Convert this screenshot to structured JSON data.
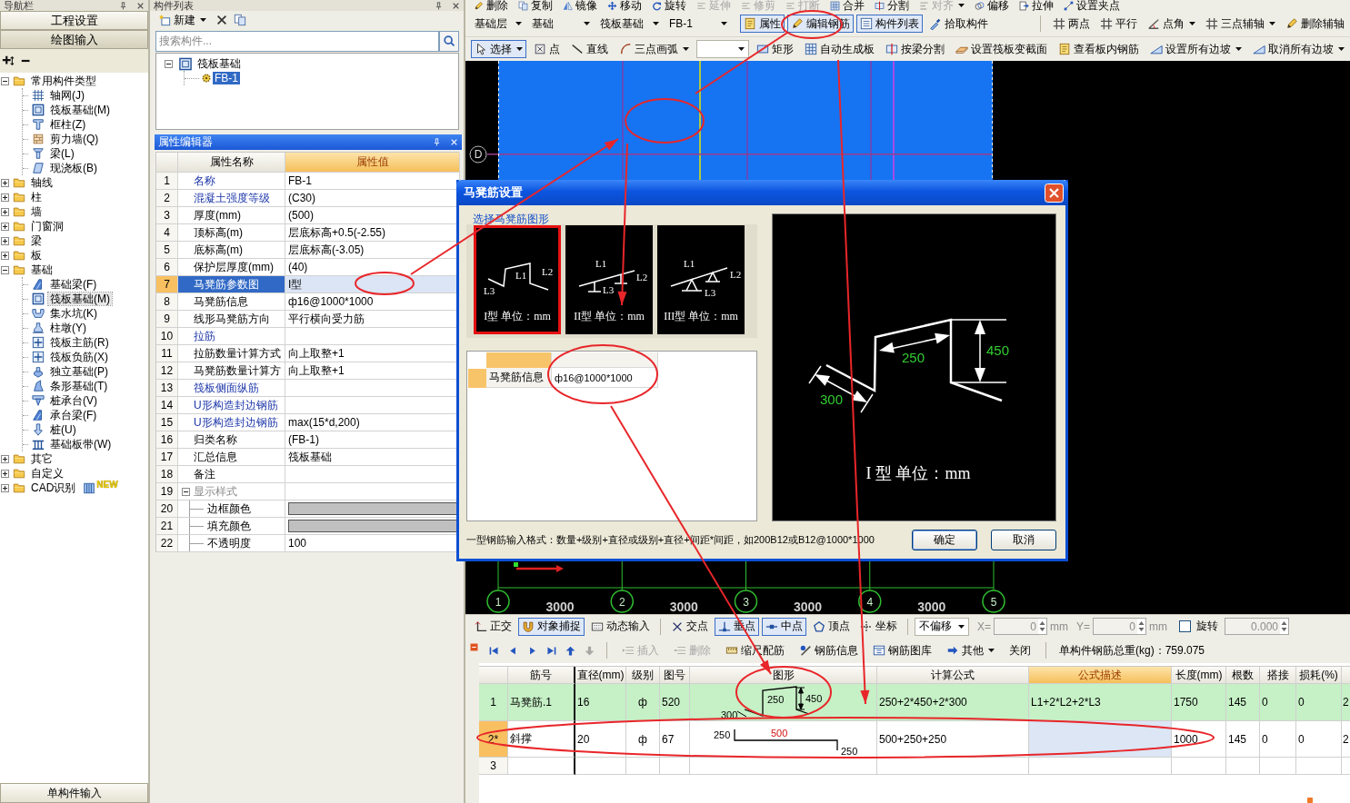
{
  "nav_panel": {
    "title": "导航栏",
    "buttons": [
      {
        "label": "工程设置",
        "selected": false
      },
      {
        "label": "绘图输入",
        "selected": true
      }
    ],
    "tree": [
      {
        "label": "常用构件类型",
        "kind": "folder",
        "expanded": true,
        "selected": false,
        "children": [
          {
            "label": "轴网(J)",
            "kind": "grid",
            "selected": false
          },
          {
            "label": "筏板基础(M)",
            "kind": "raft",
            "selected": false
          },
          {
            "label": "框柱(Z)",
            "kind": "column",
            "selected": false
          },
          {
            "label": "剪力墙(Q)",
            "kind": "wall",
            "selected": false
          },
          {
            "label": "梁(L)",
            "kind": "beam",
            "selected": false
          },
          {
            "label": "现浇板(B)",
            "kind": "slab",
            "selected": false
          }
        ]
      },
      {
        "label": "轴线",
        "kind": "folder",
        "expanded": false,
        "selected": false
      },
      {
        "label": "柱",
        "kind": "folder",
        "expanded": false,
        "selected": false
      },
      {
        "label": "墙",
        "kind": "folder",
        "expanded": false,
        "selected": false
      },
      {
        "label": "门窗洞",
        "kind": "folder",
        "expanded": false,
        "selected": false
      },
      {
        "label": "梁",
        "kind": "folder",
        "expanded": false,
        "selected": false
      },
      {
        "label": "板",
        "kind": "folder",
        "expanded": false,
        "selected": false
      },
      {
        "label": "基础",
        "kind": "folder",
        "expanded": true,
        "selected": false,
        "children": [
          {
            "label": "基础梁(F)",
            "kind": "footbeam",
            "selected": false
          },
          {
            "label": "筏板基础(M)",
            "kind": "raft",
            "selected": true
          },
          {
            "label": "集水坑(K)",
            "kind": "pit",
            "selected": false
          },
          {
            "label": "柱墩(Y)",
            "kind": "pier",
            "selected": false
          },
          {
            "label": "筏板主筋(R)",
            "kind": "rebar",
            "selected": false
          },
          {
            "label": "筏板负筋(X)",
            "kind": "rebar",
            "selected": false
          },
          {
            "label": "独立基础(P)",
            "kind": "footing",
            "selected": false
          },
          {
            "label": "条形基础(T)",
            "kind": "strip",
            "selected": false
          },
          {
            "label": "桩承台(V)",
            "kind": "cap",
            "selected": false
          },
          {
            "label": "承台梁(F)",
            "kind": "footbeam",
            "selected": false
          },
          {
            "label": "桩(U)",
            "kind": "pile",
            "selected": false
          },
          {
            "label": "基础板带(W)",
            "kind": "band",
            "selected": false
          }
        ]
      },
      {
        "label": "其它",
        "kind": "folder",
        "expanded": false,
        "selected": false
      },
      {
        "label": "自定义",
        "kind": "folder",
        "expanded": false,
        "selected": false
      },
      {
        "label": "CAD识别",
        "kind": "folder",
        "expanded": false,
        "selected": false,
        "badge": "NEW"
      }
    ],
    "footer_button": "单构件输入"
  },
  "component_list": {
    "title": "构件列表",
    "new_button": "新建",
    "search": {
      "placeholder": "搜索构件..."
    },
    "tree": [
      {
        "label": "筏板基础",
        "kind": "group",
        "expanded": true,
        "selected": false,
        "children": [
          {
            "label": "FB-1",
            "kind": "component",
            "selected": true
          }
        ]
      }
    ]
  },
  "property_editor": {
    "title": "属性编辑器",
    "columns": [
      {
        "label": "属性名称",
        "selected": false
      },
      {
        "label": "属性值",
        "selected": true
      }
    ],
    "rows": [
      {
        "index": "1",
        "name": "名称",
        "value": "FB-1",
        "kind": "text",
        "public": true,
        "selected": false
      },
      {
        "index": "2",
        "name": "混凝土强度等级",
        "value": "(C30)",
        "kind": "text",
        "public": true,
        "selected": false
      },
      {
        "index": "3",
        "name": "厚度(mm)",
        "value": "(500)",
        "kind": "text",
        "public": false,
        "selected": false
      },
      {
        "index": "4",
        "name": "顶标高(m)",
        "value": "层底标高+0.5(-2.55)",
        "kind": "text",
        "public": false,
        "selected": false
      },
      {
        "index": "5",
        "name": "底标高(m)",
        "value": "层底标高(-3.05)",
        "kind": "text",
        "public": false,
        "selected": false
      },
      {
        "index": "6",
        "name": "保护层厚度(mm)",
        "value": "(40)",
        "kind": "text",
        "public": false,
        "selected": false
      },
      {
        "index": "7",
        "name": "马凳筋参数图",
        "value": "I型",
        "kind": "text",
        "public": true,
        "selected": true
      },
      {
        "index": "8",
        "name": "马凳筋信息",
        "value": "ф16@1000*1000",
        "kind": "text",
        "public": false,
        "selected": false
      },
      {
        "index": "9",
        "name": "线形马凳筋方向",
        "value": "平行横向受力筋",
        "kind": "text",
        "public": false,
        "selected": false
      },
      {
        "index": "10",
        "name": "拉筋",
        "kind": "text",
        "public": true,
        "selected": false
      },
      {
        "index": "11",
        "name": "拉筋数量计算方式",
        "value": "向上取整+1",
        "kind": "text",
        "public": false,
        "selected": false
      },
      {
        "index": "12",
        "name": "马凳筋数量计算方",
        "value": "向上取整+1",
        "kind": "text",
        "public": false,
        "selected": false
      },
      {
        "index": "13",
        "name": "筏板侧面纵筋",
        "kind": "text",
        "public": true,
        "selected": false
      },
      {
        "index": "14",
        "name": "U形构造封边钢筋",
        "kind": "text",
        "public": true,
        "selected": false
      },
      {
        "index": "15",
        "name": "U形构造封边钢筋",
        "value": "max(15*d,200)",
        "kind": "text",
        "public": true,
        "selected": false
      },
      {
        "index": "16",
        "name": "归类名称",
        "value": "(FB-1)",
        "kind": "text",
        "public": false,
        "selected": false
      },
      {
        "index": "17",
        "name": "汇总信息",
        "value": "筏板基础",
        "kind": "text",
        "public": false,
        "selected": false
      },
      {
        "index": "18",
        "name": "备注",
        "kind": "text",
        "public": false,
        "selected": false
      },
      {
        "index": "19",
        "name": "显示样式",
        "kind": "group",
        "expanded": true,
        "public": false,
        "selected": false,
        "children": [
          {
            "index": "20",
            "name": "边框颜色",
            "kind": "swatch",
            "public": false,
            "selected": false
          },
          {
            "index": "21",
            "name": "填充颜色",
            "kind": "swatch",
            "public": false,
            "selected": false
          },
          {
            "index": "22",
            "name": "不透明度",
            "value": "100",
            "kind": "text",
            "public": false,
            "selected": false
          }
        ]
      }
    ]
  },
  "edit_toolbar": [
    {
      "label": "删除",
      "disabled": false,
      "dropdown": false
    },
    {
      "label": "复制",
      "disabled": false,
      "dropdown": false
    },
    {
      "label": "镜像",
      "disabled": false,
      "dropdown": false
    },
    {
      "label": "移动",
      "disabled": false,
      "dropdown": false
    },
    {
      "label": "旋转",
      "disabled": false,
      "dropdown": false
    },
    {
      "label": "延伸",
      "disabled": true,
      "dropdown": false
    },
    {
      "label": "修剪",
      "disabled": true,
      "dropdown": false
    },
    {
      "label": "打断",
      "disabled": true,
      "dropdown": false
    },
    {
      "label": "合并",
      "disabled": false,
      "dropdown": false
    },
    {
      "label": "分割",
      "disabled": false,
      "dropdown": false
    },
    {
      "label": "对齐",
      "disabled": true,
      "dropdown": true
    },
    {
      "label": "偏移",
      "disabled": false,
      "dropdown": false
    },
    {
      "label": "拉伸",
      "disabled": false,
      "dropdown": false
    },
    {
      "label": "设置夹点",
      "disabled": false,
      "dropdown": false
    }
  ],
  "layer_toolbar": {
    "selectors": [
      {
        "value": "基础层"
      },
      {
        "value": "基础"
      },
      {
        "value": "筏板基础"
      },
      {
        "value": "FB-1"
      }
    ],
    "buttons": [
      {
        "label": "属性",
        "pressed": true
      },
      {
        "label": "编辑钢筋",
        "pressed": true
      },
      {
        "label": "构件列表",
        "pressed": true
      },
      {
        "label": "拾取构件",
        "pressed": false
      }
    ],
    "axis_buttons": [
      {
        "label": "两点",
        "dropdown": false
      },
      {
        "label": "平行",
        "dropdown": false
      },
      {
        "label": "点角",
        "dropdown": true
      },
      {
        "label": "三点辅轴",
        "dropdown": true
      },
      {
        "label": "删除辅轴",
        "dropdown": false
      }
    ]
  },
  "draw_toolbar": [
    {
      "kind": "button",
      "label": "选择",
      "pressed": true,
      "dropdown": true
    },
    {
      "kind": "button",
      "label": "点",
      "pressed": false,
      "dropdown": false
    },
    {
      "kind": "button",
      "label": "直线",
      "pressed": false,
      "dropdown": false
    },
    {
      "kind": "button",
      "label": "三点画弧",
      "pressed": false,
      "dropdown": true
    },
    {
      "kind": "combo"
    },
    {
      "kind": "button",
      "label": "矩形",
      "pressed": false,
      "dropdown": false
    },
    {
      "kind": "button",
      "label": "自动生成板",
      "pressed": false,
      "dropdown": false
    },
    {
      "kind": "button",
      "label": "按梁分割",
      "pressed": false,
      "dropdown": false
    },
    {
      "kind": "button",
      "label": "设置筏板变截面",
      "pressed": false,
      "dropdown": false
    },
    {
      "kind": "button",
      "label": "查看板内钢筋",
      "pressed": false,
      "dropdown": false
    },
    {
      "kind": "button",
      "label": "设置所有边坡",
      "pressed": false,
      "dropdown": true
    },
    {
      "kind": "button",
      "label": "取消所有边坡",
      "pressed": false,
      "dropdown": true
    }
  ],
  "canvas": {
    "row_axes": [
      "D"
    ],
    "column_axes": [
      "1",
      "2",
      "3",
      "4",
      "5"
    ],
    "spacings": [
      "3000",
      "3000",
      "3000",
      "3000"
    ]
  },
  "dialog": {
    "title": "马凳筋设置",
    "group_label": "选择马凳筋图形",
    "shapes": [
      {
        "kind": "type1",
        "caption": "I型 单位：mm",
        "labels": [
          "L1",
          "L2",
          "L3"
        ],
        "selected": true
      },
      {
        "kind": "type2",
        "caption": "II型 单位：mm",
        "labels": [
          "L1",
          "L2",
          "L3"
        ],
        "selected": false
      },
      {
        "kind": "type3",
        "caption": "III型 单位：mm",
        "labels": [
          "L1",
          "L2",
          "L3"
        ],
        "selected": false
      }
    ],
    "info": {
      "label": "马凳筋信息",
      "value": "ф16@1000*1000"
    },
    "preview": {
      "kind": "type1",
      "dims": [
        "250",
        "450",
        "300"
      ],
      "caption": "I 型 单位：mm"
    },
    "hint": "一型钢筋输入格式：数量+级别+直径或级别+直径+间距*间距，如200B12或B12@1000*1000",
    "buttons": [
      {
        "label": "确定",
        "default": true
      },
      {
        "label": "取消",
        "default": false
      }
    ]
  },
  "snap_toolbar": {
    "modes": [
      {
        "label": "正交",
        "pressed": false
      },
      {
        "label": "对象捕捉",
        "pressed": true
      },
      {
        "label": "动态输入",
        "pressed": false
      }
    ],
    "snaps": [
      {
        "label": "交点",
        "pressed": false
      },
      {
        "label": "垂点",
        "pressed": true
      },
      {
        "label": "中点",
        "pressed": true
      },
      {
        "label": "顶点",
        "pressed": false
      },
      {
        "label": "坐标",
        "pressed": false
      }
    ],
    "offset_mode": "不偏移",
    "x": {
      "label": "X=",
      "value": "0",
      "unit": "mm",
      "disabled": true
    },
    "y": {
      "label": "Y=",
      "value": "0",
      "unit": "mm",
      "disabled": true
    },
    "rotate": {
      "label": "旋转",
      "checked": false,
      "value": "0.000"
    }
  },
  "rebar_panel": {
    "nav_buttons": [
      {
        "kind": "first",
        "disabled": false
      },
      {
        "kind": "prev",
        "disabled": false
      },
      {
        "kind": "next",
        "disabled": false
      },
      {
        "kind": "last",
        "disabled": false
      },
      {
        "kind": "up",
        "disabled": false
      },
      {
        "kind": "down",
        "disabled": true
      }
    ],
    "toolbar": [
      {
        "label": "插入",
        "disabled": true,
        "dropdown": false
      },
      {
        "label": "删除",
        "disabled": true,
        "dropdown": false
      },
      {
        "label": "缩尺配筋",
        "disabled": false,
        "dropdown": false
      },
      {
        "label": "钢筋信息",
        "disabled": false,
        "dropdown": false
      },
      {
        "label": "钢筋图库",
        "disabled": false,
        "dropdown": false
      },
      {
        "label": "其他",
        "disabled": false,
        "dropdown": true
      },
      {
        "label": "关闭",
        "disabled": false,
        "dropdown": false
      }
    ],
    "total": "单构件钢筋总重(kg)：759.075",
    "columns": [
      {
        "label": "筋号",
        "selected": false
      },
      {
        "label": "直径(mm)",
        "selected": false
      },
      {
        "label": "级别",
        "selected": false
      },
      {
        "label": "图号",
        "selected": false
      },
      {
        "label": "图形",
        "selected": false
      },
      {
        "label": "计算公式",
        "selected": false
      },
      {
        "label": "公式描述",
        "selected": true
      },
      {
        "label": "长度(mm)",
        "selected": false
      },
      {
        "label": "根数",
        "selected": false
      },
      {
        "label": "搭接",
        "selected": false
      },
      {
        "label": "损耗(%)",
        "selected": false
      }
    ],
    "rows": [
      {
        "index": "1",
        "bar": "马凳筋.1",
        "diameter": "16",
        "grade": "ф",
        "shape_no": "520",
        "shape": {
          "kind": "stool",
          "dims": [
            {
              "text": "250",
              "highlighted": false
            },
            {
              "text": "450",
              "highlighted": false
            },
            {
              "text": "300",
              "highlighted": false
            }
          ]
        },
        "formula": "250+2*450+2*300",
        "description": "L1+2*L2+2*L3",
        "length": "1750",
        "count": "145",
        "lap": "0",
        "loss": "0",
        "column_13": "2",
        "highlighted": true,
        "selected": false
      },
      {
        "index": "2*",
        "bar": "斜撑",
        "diameter": "20",
        "grade": "ф",
        "shape_no": "67",
        "shape": {
          "kind": "bent",
          "dims": [
            {
              "text": "250",
              "highlighted": false
            },
            {
              "text": "500",
              "highlighted": true
            },
            {
              "text": "250",
              "highlighted": false
            }
          ]
        },
        "formula": "500+250+250",
        "length": "1000",
        "count": "145",
        "lap": "0",
        "loss": "0",
        "column_13": "2",
        "highlighted": false,
        "selected": true
      },
      {
        "index": "3",
        "highlighted": false,
        "selected": false
      }
    ]
  },
  "annotations": [
    {
      "kind": "ellipse"
    },
    {
      "kind": "line"
    },
    {
      "kind": "ellipse"
    },
    {
      "kind": "arrow"
    },
    {
      "kind": "ellipse"
    },
    {
      "kind": "arrow"
    },
    {
      "kind": "arrow"
    },
    {
      "kind": "ellipse"
    },
    {
      "kind": "arrow"
    },
    {
      "kind": "ellipse"
    },
    {
      "kind": "ellipse"
    }
  ]
}
